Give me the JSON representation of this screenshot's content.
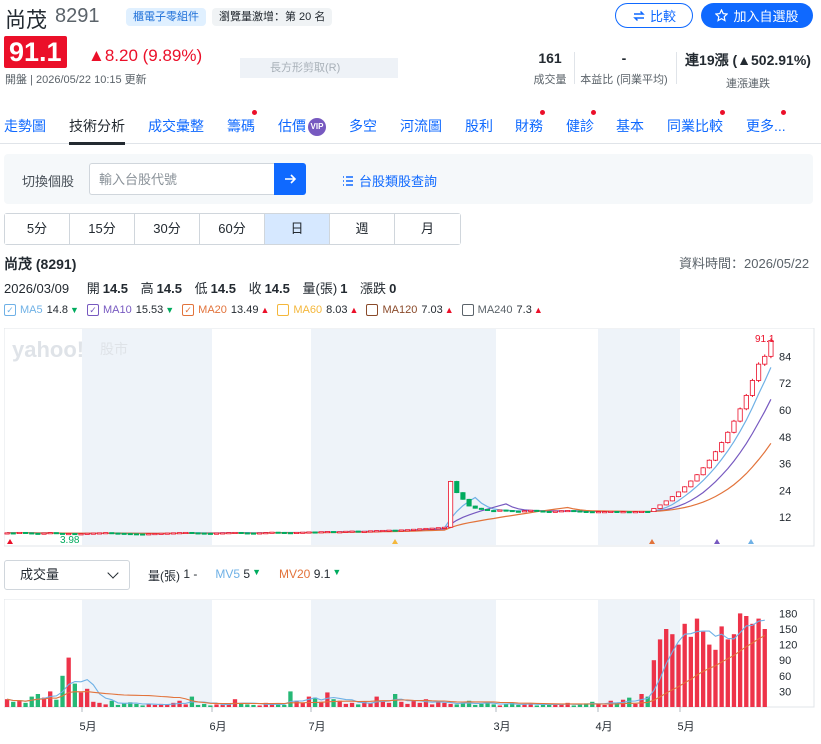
{
  "header": {
    "name": "尚茂",
    "code": "8291",
    "category_tag": "櫃電子零組件",
    "views_tag": "瀏覽量激增：第 20 名",
    "compare_label": "比較",
    "add_watch_label": "加入自選股",
    "price": "91.1",
    "change": "▲8.20 (9.89%)",
    "status": "開盤 | 2026/05/22 10:15 更新",
    "ghost_text": "長方形剪取(R)"
  },
  "stats": [
    {
      "value": "161",
      "label": "成交量"
    },
    {
      "value": "-",
      "label": "本益比 (同業平均)"
    },
    {
      "value": "連19漲 (▲502.91%)",
      "label": "連漲連跌"
    }
  ],
  "tabs": [
    {
      "label": "走勢圖"
    },
    {
      "label": "技術分析"
    },
    {
      "label": "成交彙整"
    },
    {
      "label": "籌碼"
    },
    {
      "label": "估價"
    },
    {
      "label": "多空"
    },
    {
      "label": "河流圖"
    },
    {
      "label": "股利"
    },
    {
      "label": "財務"
    },
    {
      "label": "健診"
    },
    {
      "label": "基本"
    },
    {
      "label": "同業比較"
    },
    {
      "label": "更多..."
    }
  ],
  "vip_badge": "VIP",
  "search": {
    "label": "切換個股",
    "placeholder": "輸入台股代號",
    "category_link": "台股類股查詢"
  },
  "periods": [
    "5分",
    "15分",
    "30分",
    "60分",
    "日",
    "週",
    "月"
  ],
  "active_period": "日",
  "chart_title": "尚茂 (8291)",
  "data_time": "資料時間：2026/05/22",
  "ohlc": {
    "date": "2026/03/09",
    "open_label": "開",
    "open": "14.5",
    "high_label": "高",
    "high": "14.5",
    "low_label": "低",
    "low": "14.5",
    "close_label": "收",
    "close": "14.5",
    "vol_label": "量(張)",
    "vol": "1",
    "chg_label": "漲跌",
    "chg": "0"
  },
  "ma_legend": [
    {
      "name": "MA5",
      "value": "14.8",
      "dir": "down",
      "color": "#6fb1e6",
      "checked": true
    },
    {
      "name": "MA10",
      "value": "15.53",
      "dir": "down",
      "color": "#7759c0",
      "checked": true
    },
    {
      "name": "MA20",
      "value": "13.49",
      "dir": "up",
      "color": "#e2733b",
      "checked": true
    },
    {
      "name": "MA60",
      "value": "8.03",
      "dir": "up",
      "color": "#f4b73b",
      "checked": false
    },
    {
      "name": "MA120",
      "value": "7.03",
      "dir": "up",
      "color": "#8a4a2a",
      "checked": false
    },
    {
      "name": "MA240",
      "value": "7.3",
      "dir": "up",
      "color": "#5b636a",
      "checked": false
    }
  ],
  "watermark": {
    "brand": "yahoo!",
    "sub": "股市"
  },
  "volume_selector": "成交量",
  "volume_legend": {
    "label": "量(張)",
    "value": "1 -",
    "mv5_label": "MV5",
    "mv5": "5",
    "mv20_label": "MV20",
    "mv20": "9.1"
  },
  "chart_data": {
    "type": "candlestick",
    "price_axis": {
      "ticks": [
        12,
        24,
        36,
        48,
        60,
        72,
        84
      ],
      "range": [
        0,
        94
      ]
    },
    "volume_axis": {
      "ticks": [
        30,
        60,
        90,
        120,
        150,
        180
      ],
      "range": [
        0,
        200
      ]
    },
    "x_labels": [
      "5月",
      "6月",
      "7月",
      "3月",
      "4月",
      "5月"
    ],
    "last_price_label": "91.1",
    "min_label": "3.98",
    "close": [
      5.0,
      4.9,
      5.2,
      5.0,
      4.8,
      4.7,
      4.9,
      5.1,
      4.8,
      4.6,
      4.7,
      4.5,
      4.6,
      4.8,
      4.9,
      5.0,
      5.1,
      4.9,
      4.8,
      4.7,
      4.6,
      4.5,
      4.4,
      4.6,
      4.7,
      4.8,
      4.9,
      5.0,
      5.1,
      5.2,
      5.0,
      4.9,
      4.8,
      4.7,
      4.9,
      5.0,
      5.1,
      5.2,
      5.0,
      4.9,
      4.8,
      5.0,
      5.1,
      5.3,
      5.2,
      5.1,
      5.0,
      5.2,
      5.3,
      5.4,
      5.3,
      5.5,
      5.6,
      5.4,
      5.5,
      5.7,
      5.8,
      5.6,
      5.7,
      5.9,
      6.0,
      6.1,
      6.2,
      6.1,
      6.3,
      6.4,
      6.6,
      6.8,
      7.0,
      7.1,
      7.3,
      7.5,
      28.0,
      23.0,
      20.0,
      17.0,
      16.0,
      15.5,
      15.0,
      14.8,
      15.2,
      15.0,
      14.7,
      14.5,
      14.9,
      15.1,
      14.8,
      14.6,
      14.5,
      14.7,
      14.9,
      15.0,
      14.8,
      14.6,
      14.5,
      14.4,
      14.5,
      14.5,
      14.6,
      14.4,
      14.5,
      14.3,
      14.5,
      14.6,
      14.5,
      15.9,
      17.5,
      19.3,
      21.2,
      23.3,
      25.6,
      28.2,
      31.0,
      34.1,
      37.5,
      41.3,
      45.4,
      50.0,
      55.0,
      60.5,
      66.5,
      73.2,
      80.5,
      84.0,
      91.1
    ],
    "volume": [
      15,
      10,
      12,
      8,
      20,
      25,
      18,
      30,
      14,
      60,
      95,
      45,
      28,
      35,
      10,
      8,
      5,
      12,
      4,
      7,
      9,
      6,
      3,
      5,
      4,
      6,
      5,
      8,
      12,
      5,
      20,
      4,
      6,
      3,
      5,
      4,
      7,
      15,
      6,
      5,
      4,
      3,
      8,
      6,
      5,
      4,
      30,
      12,
      8,
      20,
      18,
      10,
      28,
      15,
      12,
      6,
      8,
      5,
      10,
      7,
      20,
      12,
      8,
      25,
      10,
      6,
      12,
      8,
      15,
      5,
      10,
      8,
      6,
      5,
      8,
      12,
      4,
      6,
      10,
      5,
      3,
      6,
      8,
      4,
      5,
      6,
      3,
      7,
      5,
      4,
      6,
      8,
      3,
      5,
      7,
      10,
      6,
      4,
      12,
      8,
      14,
      18,
      6,
      25,
      20,
      90,
      130,
      150,
      140,
      120,
      160,
      135,
      170,
      145,
      120,
      110,
      155,
      130,
      140,
      180,
      175,
      160,
      170,
      150
    ]
  }
}
